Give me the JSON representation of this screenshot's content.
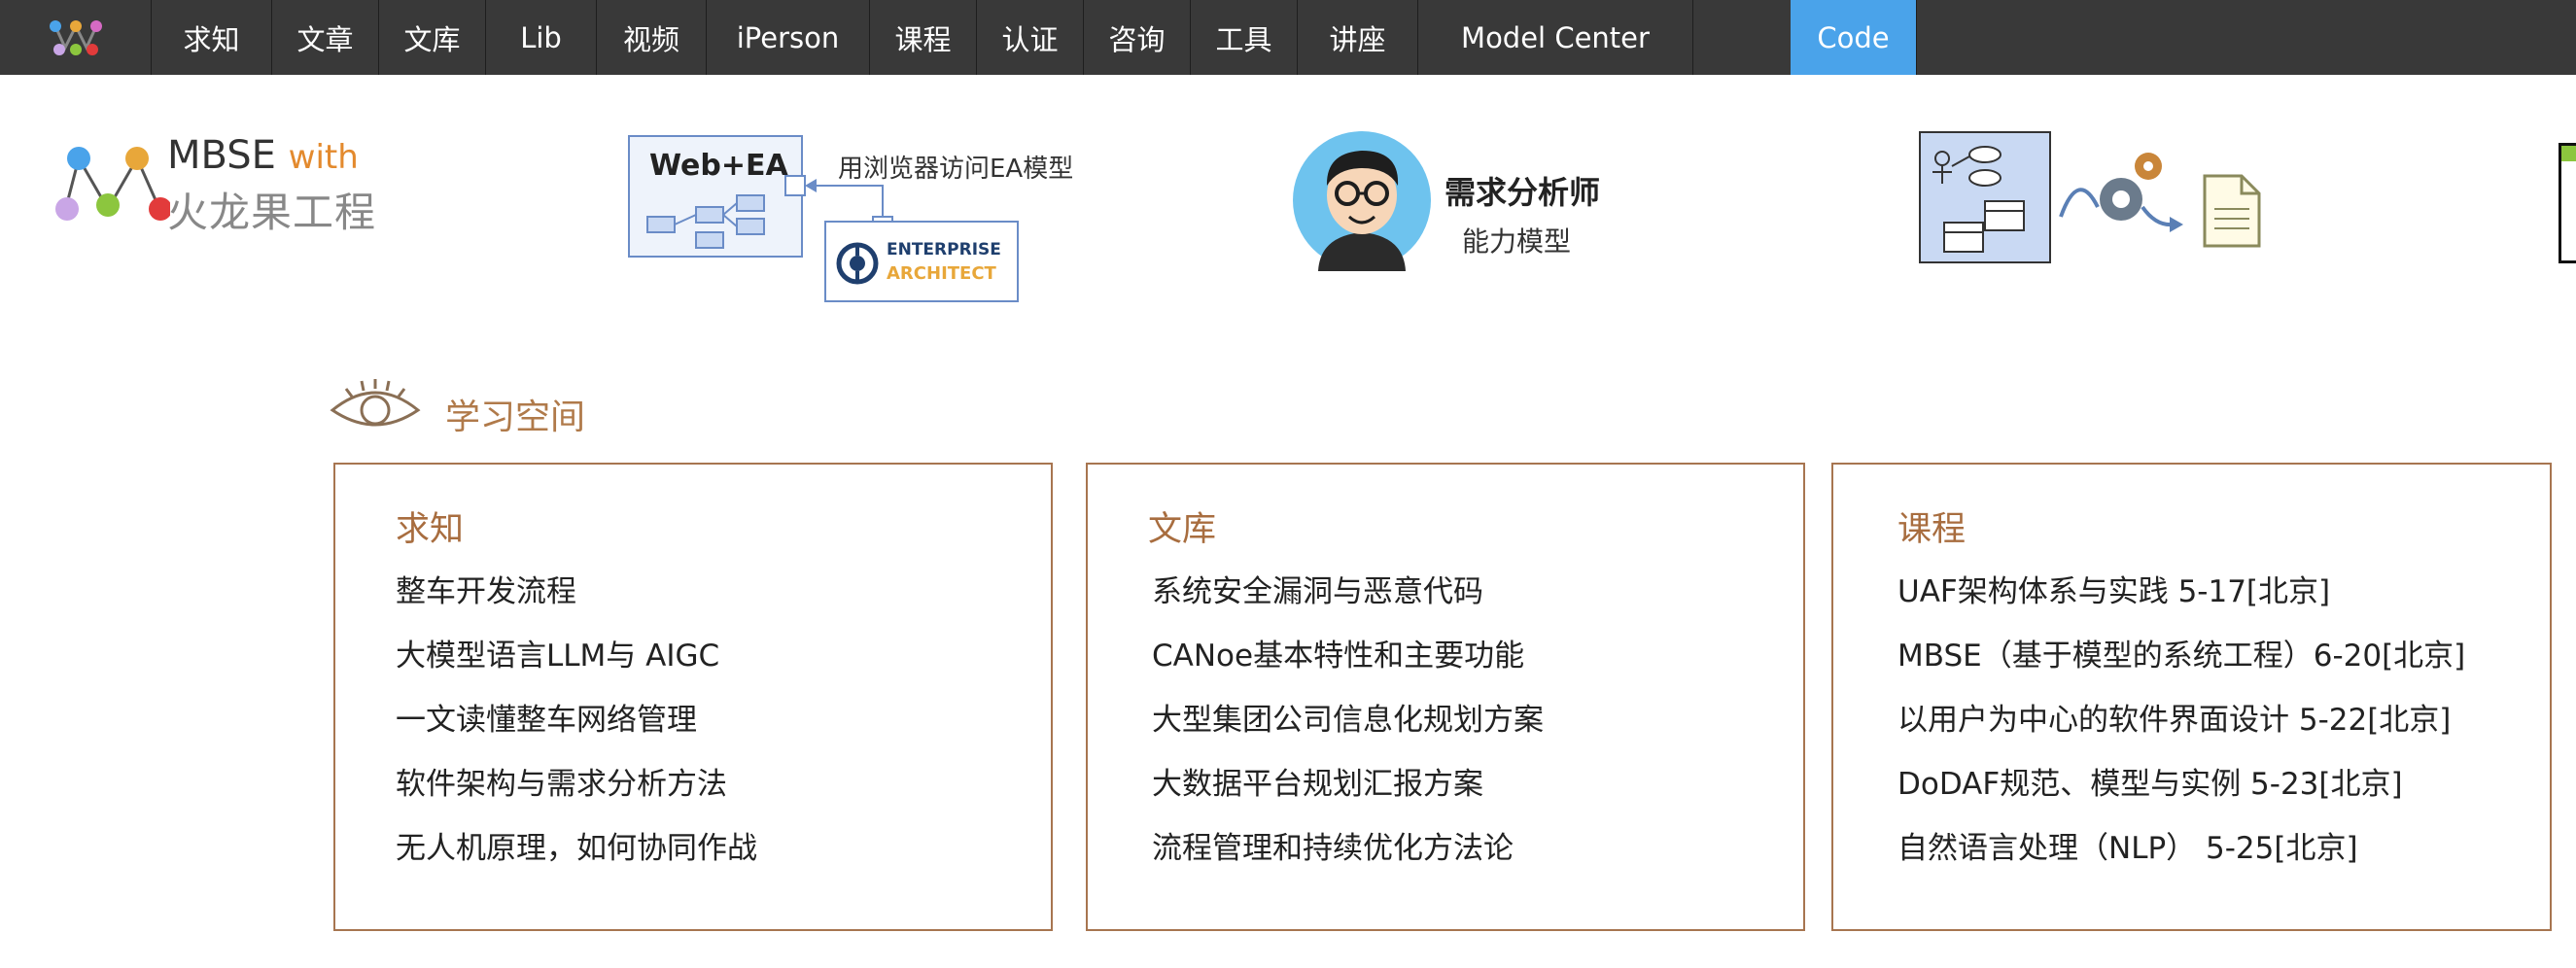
{
  "nav": {
    "items": [
      {
        "label": "求知"
      },
      {
        "label": "文章"
      },
      {
        "label": "文库"
      },
      {
        "label": "Lib"
      },
      {
        "label": "视频"
      },
      {
        "label": "iPerson"
      },
      {
        "label": "课程"
      },
      {
        "label": "认证"
      },
      {
        "label": "咨询"
      },
      {
        "label": "工具"
      },
      {
        "label": "讲座"
      },
      {
        "label": "Model Center"
      },
      {
        "label": "Code",
        "active": true
      }
    ]
  },
  "banner": {
    "mbse_line1": "MBSE",
    "mbse_with": "with",
    "mbse_line2": "火龙果工程",
    "web_ea": "Web+EA",
    "ea_caption": "用浏览器访问EA模型",
    "enterprise": "ENTERPRISE",
    "architect": "ARCHITECT",
    "req_title": "需求分析师",
    "req_sub": "能力模型"
  },
  "learning_space": {
    "title": "学习空间",
    "cards": [
      {
        "title": "求知",
        "items": [
          "整车开发流程",
          "大模型语言LLM与 AIGC",
          "一文读懂整车网络管理",
          "软件架构与需求分析方法",
          "无人机原理，如何协同作战"
        ]
      },
      {
        "title": "文库",
        "items": [
          "系统安全漏洞与恶意代码",
          "CANoe基本特性和主要功能",
          "大型集团公司信息化规划方案",
          "大数据平台规划汇报方案",
          "流程管理和持续优化方法论"
        ]
      },
      {
        "title": "课程",
        "items": [
          "UAF架构体系与实践 5-17[北京]",
          "MBSE（基于模型的系统工程）6-20[北京]",
          "以用户为中心的软件界面设计 5-22[北京]",
          "DoDAF规范、模型与实例 5-23[北京]",
          "自然语言处理（NLP） 5-25[北京]"
        ]
      }
    ]
  },
  "colors": {
    "nav_bg": "#393939",
    "nav_active": "#4aa3ea",
    "card_border": "#a77550",
    "card_title": "#a86d3f",
    "section_title": "#b07a4a"
  }
}
